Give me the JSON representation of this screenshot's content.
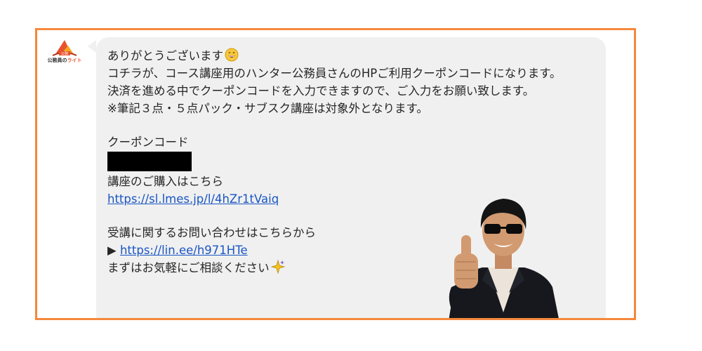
{
  "sender": {
    "avatar_label_prefix": "公務員の",
    "avatar_label_accent": "ライト",
    "avatar_badge": "公務"
  },
  "message": {
    "greeting": "ありがとうございます",
    "greeting_emoji": "grinning-face-icon",
    "line2": "コチラが、コース講座用のハンター公務員さんのHPご利用クーポンコードになります。",
    "line3": "決済を進める中でクーポンコードを入力できますので、ご入力をお願い致します。",
    "line4": "※筆記３点・５点パック・サブスク講座は対象外となります。",
    "coupon_heading": "クーポンコード",
    "purchase_heading": "講座のご購入はこちら",
    "purchase_url": "https://sl.lmes.jp/l/4hZr1tVaiq",
    "inquiry_heading": "受講に関するお問い合わせはこちらから",
    "inquiry_arrow": "▶",
    "inquiry_url": "https://lin.ee/h971HTe",
    "closing": "まずはお気軽にご相談ください",
    "closing_emoji": "sparkles-icon"
  },
  "colors": {
    "frame_border": "#f5883c",
    "bubble_bg": "#f0f0f0",
    "link": "#1a56c4",
    "text": "#262626"
  }
}
